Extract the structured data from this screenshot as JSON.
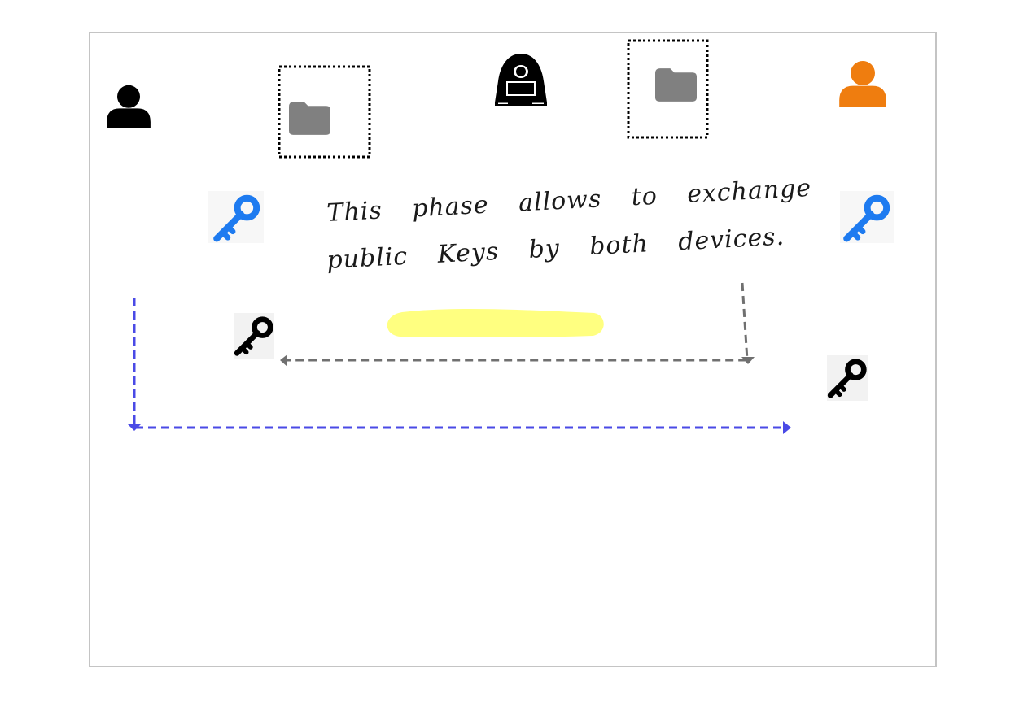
{
  "note": {
    "line1": "This phase allows to exchange",
    "line2": "public Keys by both devices."
  },
  "icons": {
    "user_left": "user-icon",
    "user_right": "user-icon",
    "attacker": "hacker-icon",
    "folder_left": "folder-icon",
    "folder_right": "folder-icon",
    "public_key_left": "key-icon",
    "public_key_right": "key-icon",
    "private_key_left": "key-icon",
    "private_key_right": "key-icon"
  },
  "colors": {
    "user_left": "#000000",
    "user_right": "#ef7d0f",
    "folder": "#808080",
    "public_key": "#1e7bf0",
    "private_key": "#000000",
    "highlight": "#ffff80",
    "arrow_blue": "#4a4ae6",
    "arrow_gray": "#707070"
  }
}
